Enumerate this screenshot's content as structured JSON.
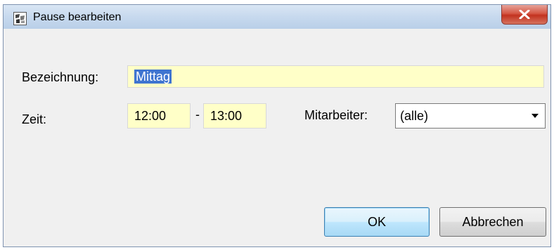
{
  "window": {
    "title": "Pause bearbeiten",
    "app_icon": "app-icon",
    "close_icon": "close-icon"
  },
  "form": {
    "bezeichnung_label": "Bezeichnung:",
    "bezeichnung_value": "Mittag",
    "zeit_label": "Zeit:",
    "zeit_von": "12:00",
    "zeit_separator": "-",
    "zeit_bis": "13:00",
    "mitarbeiter_label": "Mitarbeiter:",
    "mitarbeiter_value": "(alle)"
  },
  "buttons": {
    "ok_label": "OK",
    "cancel_label": "Abbrechen"
  },
  "colors": {
    "input_background": "#ffffc8",
    "selection": "#3f75d0",
    "close_button": "#c2321f"
  }
}
